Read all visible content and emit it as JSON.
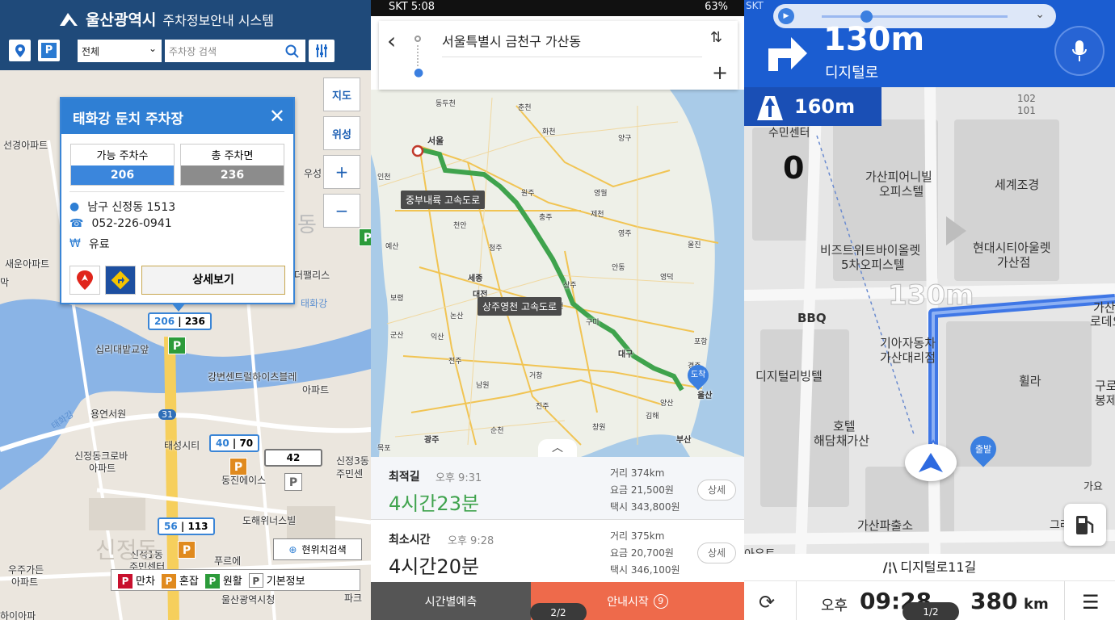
{
  "panel1": {
    "header": {
      "logo": "울산광역시",
      "subtitle": "주차정보안내 시스템",
      "filter_value": "전체",
      "search_placeholder": "주차장 검색"
    },
    "map_buttons": {
      "map": "지도",
      "satellite": "위성",
      "zoom_in": "+",
      "zoom_out": "−"
    },
    "popup": {
      "title": "태화강 둔치 주차장",
      "available_label": "가능 주차수",
      "available": "206",
      "total_label": "총 주차면",
      "total": "236",
      "address": "남구 신정동 1513",
      "phone": "052-226-0941",
      "fee": "유료",
      "detail_button": "상세보기"
    },
    "markers": [
      {
        "avail": "206",
        "total": "236"
      },
      {
        "avail": "40",
        "total": "70"
      },
      {
        "avail": "",
        "total": "42"
      },
      {
        "avail": "56",
        "total": "113"
      }
    ],
    "map_labels": [
      "선경아파트",
      "새운아파트",
      "막",
      "우성",
      "동",
      "더팰리스",
      "태화강",
      "십리대밭교앞",
      "강변센트럴하이츠블레",
      "아파트",
      "용연서원",
      "31",
      "태성시티",
      "신정동크로바",
      "아파트",
      "동진에이스",
      "신정3동",
      "주민센",
      "도해위너스빌",
      "신정1동",
      "주민센터",
      "푸르에",
      "우주가든",
      "아파트",
      "울산광역시청",
      "파크",
      "신정동",
      "태화강",
      "하이아파"
    ],
    "current_location_button": "현위치검색",
    "legend": [
      {
        "key": "P",
        "label": "만차",
        "color": "#c8102e"
      },
      {
        "key": "P",
        "label": "혼잡",
        "color": "#e08a1e"
      },
      {
        "key": "P",
        "label": "원활",
        "color": "#2c9b3a"
      },
      {
        "key": "P",
        "label": "기본정보",
        "color": "#ffffff"
      }
    ]
  },
  "panel2": {
    "status_bar": {
      "carrier": "SKT",
      "time": "5:08",
      "battery": "63%"
    },
    "route_search": {
      "origin": "서울특별시 금천구 가산동"
    },
    "highway_labels": [
      "중부내륙 고속도로",
      "상주영천 고속도로"
    ],
    "destination_pin": "도착",
    "map_labels": [
      "동두천",
      "춘천",
      "서울",
      "인천",
      "화천",
      "양구",
      "원주",
      "충주",
      "영월",
      "울진",
      "제천",
      "예산",
      "천안",
      "청주",
      "안동",
      "세종",
      "대전",
      "상주",
      "보령",
      "영주",
      "영덕",
      "논산",
      "김천",
      "구미",
      "군산",
      "익산",
      "전주",
      "대구",
      "포항",
      "경주",
      "울산",
      "진주",
      "부산",
      "광주",
      "목포",
      "순천",
      "남원",
      "거창",
      "창원",
      "김해",
      "양산"
    ],
    "routes": [
      {
        "name": "최적길",
        "eta": "오후 9:31",
        "duration": "4시간23분",
        "distance": "거리 374km",
        "toll": "요금 21,500원",
        "taxi": "택시 343,800원",
        "detail": "상세"
      },
      {
        "name": "최소시간",
        "eta": "오후 9:28",
        "duration": "4시간20분",
        "distance": "거리 375km",
        "toll": "요금 20,700원",
        "taxi": "택시 346,100원",
        "detail": "상세"
      }
    ],
    "bottom": {
      "left": "시간별예측",
      "right": "안내시작",
      "right_badge": "9",
      "pager": "2/2"
    },
    "route_color": "#3fa34d"
  },
  "panel3": {
    "status_bar": {
      "carrier": "SKT",
      "time": "5:08"
    },
    "next_turn": {
      "distance": "130m",
      "road": "디지털로"
    },
    "lane_distance": "160m",
    "speed": "0",
    "map_labels": [
      "수민센터",
      "가산피어니빌",
      "오피스텔",
      "세계조경",
      "비즈트위트바이올렛",
      "5차오피스텔",
      "현대시티아울렛",
      "가산점",
      "BBQ",
      "기아자동차",
      "가산대리점",
      "디지털리빙텔",
      "휠라",
      "호텔",
      "해담채가산",
      "가산파출소",
      "가산",
      "로데오",
      "구로",
      "봉제",
      "102",
      "101",
      "아우트",
      "그라",
      "가요"
    ],
    "overlay_distance": "130m",
    "start_pin": "출발",
    "current_road": "디지털로11길",
    "arrival_time_prefix": "오후",
    "arrival_time": "09:28",
    "remaining": "380",
    "remaining_unit": "km",
    "pager": "1/2"
  }
}
